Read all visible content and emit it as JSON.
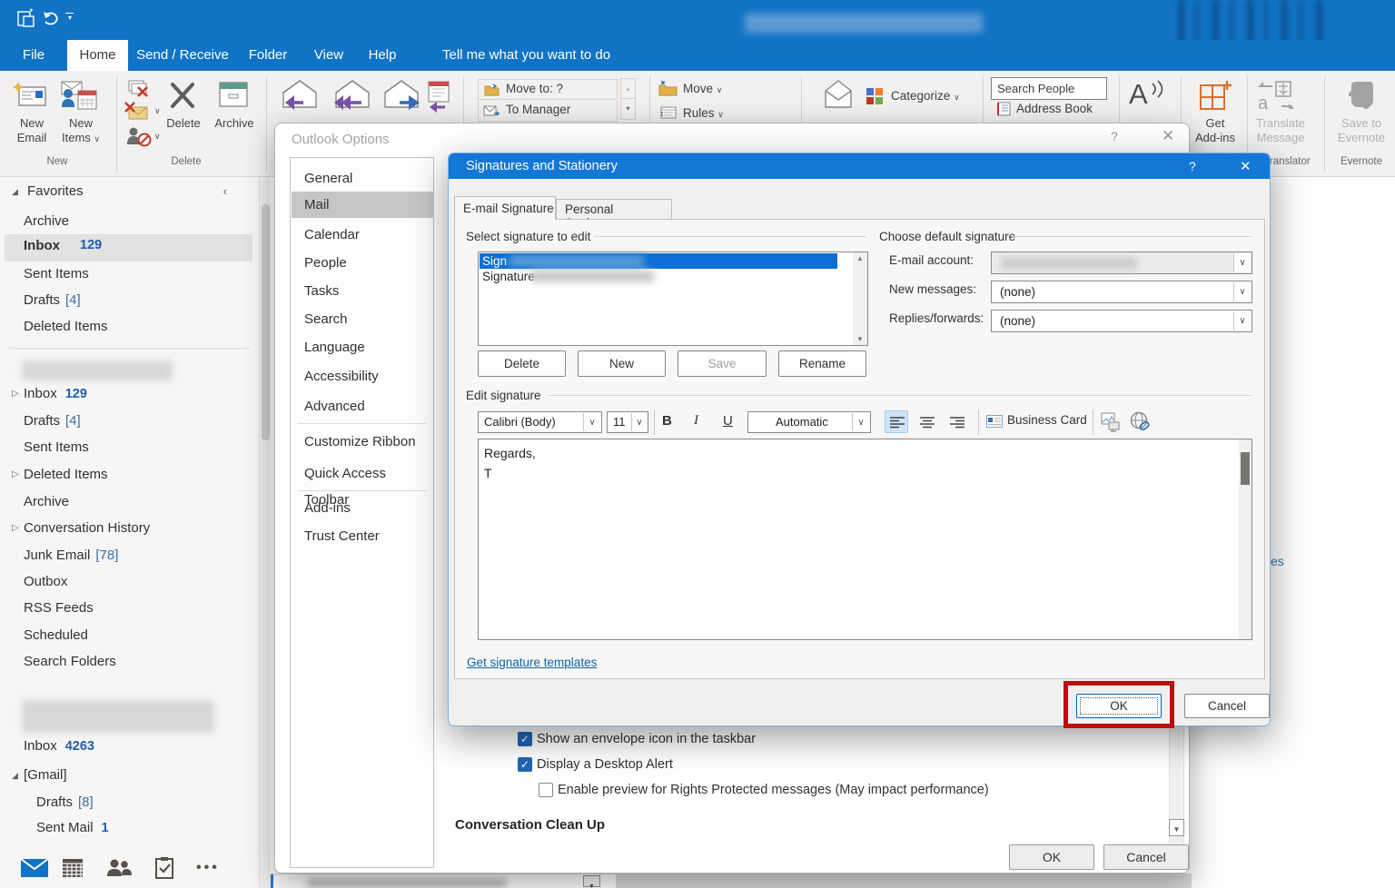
{
  "colors": {
    "titlebar": "#1173c5",
    "dialog_title": "#1377d6",
    "selection_blue": "#0c70d6",
    "annotation_red": "#bb0f0f",
    "link_blue": "#0b63a8",
    "accent_count": "#1f5fa8"
  },
  "menu": {
    "tabs": [
      "File",
      "Home",
      "Send / Receive",
      "Folder",
      "View",
      "Help"
    ],
    "active_tab": "Home",
    "tell_me": "Tell me what you want to do"
  },
  "ribbon": {
    "new_email_1": "New",
    "new_email_2": "Email",
    "new_items_1": "New",
    "new_items_2": "Items",
    "delete_label": "Delete",
    "archive_label": "Archive",
    "group_new": "New",
    "group_delete": "Delete",
    "quick_step_1": "Move to: ?",
    "quick_step_2": "To Manager",
    "move": "Move",
    "rules": "Rules",
    "categorize": "Categorize",
    "search_people": "Search People",
    "address_book": "Address Book",
    "get_addins_1": "Get",
    "get_addins_2": "Add-ins",
    "translate_1": "Translate",
    "translate_2": "Message",
    "evernote_1": "Save to",
    "evernote_2": "Evernote",
    "group_translator": "Translator",
    "group_evernote": "Evernote"
  },
  "sidebar": {
    "favorites_header": "Favorites",
    "favorites": [
      {
        "label": "Archive"
      },
      {
        "label": "Inbox",
        "count": "129"
      },
      {
        "label": "Sent Items"
      },
      {
        "label": "Drafts",
        "bracket": "[4]"
      },
      {
        "label": "Deleted Items"
      }
    ],
    "account1": [
      {
        "label": "Inbox",
        "count": "129"
      },
      {
        "label": "Drafts",
        "bracket": "[4]"
      },
      {
        "label": "Sent Items"
      },
      {
        "label": "Deleted Items"
      },
      {
        "label": "Archive"
      },
      {
        "label": "Conversation History"
      },
      {
        "label": "Junk Email",
        "bracket": "[78]"
      },
      {
        "label": "Outbox"
      },
      {
        "label": "RSS Feeds"
      },
      {
        "label": "Scheduled"
      },
      {
        "label": "Search Folders"
      }
    ],
    "account2": [
      {
        "label": "Inbox",
        "count": "4263"
      },
      {
        "label": "[Gmail]"
      },
      {
        "label": "Drafts",
        "bracket": "[8]"
      },
      {
        "label": "Sent Mail",
        "count": "1"
      }
    ]
  },
  "options_dialog": {
    "title": "Outlook Options",
    "nav": [
      "General",
      "Mail",
      "Calendar",
      "People",
      "Tasks",
      "Search",
      "Language",
      "Accessibility",
      "Advanced",
      "Customize Ribbon",
      "Quick Access Toolbar",
      "Add-ins",
      "Trust Center"
    ],
    "selected_nav": "Mail",
    "checkboxes": [
      {
        "label": "Show an envelope icon in the taskbar",
        "checked": true
      },
      {
        "label": "Display a Desktop Alert",
        "checked": true
      },
      {
        "label": "Enable preview for Rights Protected messages (May impact performance)",
        "checked": false
      }
    ],
    "section_header": "Conversation Clean Up",
    "ok": "OK",
    "cancel": "Cancel"
  },
  "sig_dialog": {
    "title": "Signatures and Stationery",
    "tab_1": "E-mail Signature",
    "tab_2": "Personal Stationery",
    "select_header": "Select signature to edit",
    "signature_1": "Sign",
    "signature_2": "Signature",
    "delete": "Delete",
    "new": "New",
    "save": "Save",
    "rename": "Rename",
    "choose_header": "Choose default signature",
    "email_account_label": "E-mail account:",
    "new_messages_label": "New messages:",
    "new_messages_value": "(none)",
    "replies_label": "Replies/forwards:",
    "replies_value": "(none)",
    "edit_header": "Edit signature",
    "font": "Calibri (Body)",
    "font_size": "11",
    "color_value": "Automatic",
    "bold": "B",
    "italic": "I",
    "underline": "U",
    "business_card": "Business Card",
    "sig_line_1": "Regards,",
    "sig_line_2": "T",
    "templates_link": "Get signature templates",
    "ok": "OK",
    "cancel": "Cancel"
  },
  "behind": {
    "partial_text": "es"
  }
}
